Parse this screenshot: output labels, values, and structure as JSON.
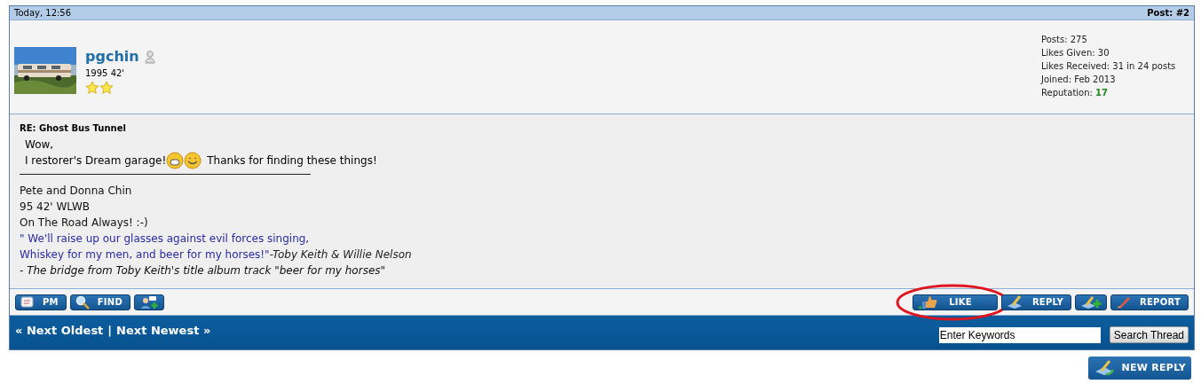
{
  "post_header": {
    "date": "Today, 12:56",
    "post_number": "Post: #2"
  },
  "user": {
    "name": "pgchin",
    "online": false,
    "title": "1995 42'",
    "rank_icons": [
      {
        "kind": "star"
      },
      {
        "kind": "star"
      }
    ],
    "stats": [
      {
        "text": "Posts: 275"
      },
      {
        "text": "Likes Given: 30"
      },
      {
        "text": "Likes Received: 31 in 24 posts"
      },
      {
        "text": "Joined: Feb 2013"
      },
      {
        "text": "Reputation: ",
        "value": "17"
      }
    ]
  },
  "message": {
    "title": "RE: Ghost Bus Tunnel",
    "greeting": "Wow,",
    "body": "I restorer's Dream garage!",
    "body_after": "Thanks for finding these things!",
    "signature": [
      {
        "kind": "plain",
        "text": "Pete and Donna Chin"
      },
      {
        "kind": "plain",
        "text": "95 42' WLWB"
      },
      {
        "kind": "plain",
        "text": "On The Road Always! :-)"
      },
      {
        "kind": "quote",
        "text": "\" We'll raise up our glasses against evil forces singing,"
      },
      {
        "kind": "quote",
        "text": "Whiskey for my men, and beer for my horses!\"",
        "attribution": "-Toby Keith & Willie Nelson"
      },
      {
        "kind": "italic",
        "text": "- The bridge from Toby Keith's title album track \"beer for my horses\""
      }
    ]
  },
  "left_buttons": [
    {
      "kind": "pm",
      "label": "PM"
    },
    {
      "kind": "find",
      "label": "FIND"
    },
    {
      "kind": "add_contact"
    }
  ],
  "right_buttons": [
    {
      "kind": "like",
      "label": "LIKE",
      "highlighted": true
    },
    {
      "kind": "reply",
      "label": "REPLY",
      "highlighted": false
    },
    {
      "kind": "multiquote",
      "highlighted": false
    },
    {
      "kind": "report",
      "label": "REPORT",
      "highlighted": false
    }
  ],
  "nav": {
    "prev": "« Next Oldest",
    "separator": "|",
    "next": "Next Newest »"
  },
  "search": {
    "value": "Enter Keywords",
    "button": "Search Thread"
  },
  "new_reply": "NEW REPLY"
}
